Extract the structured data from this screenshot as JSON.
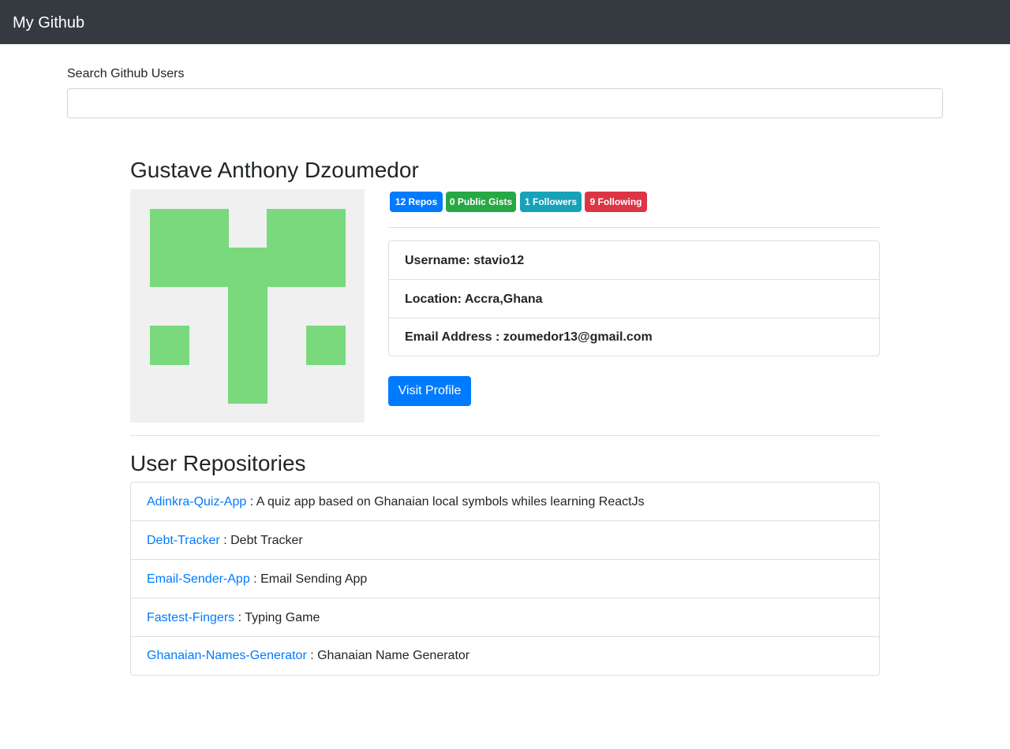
{
  "navbar": {
    "brand": "My Github"
  },
  "search": {
    "label": "Search Github Users",
    "value": "",
    "placeholder": ""
  },
  "user": {
    "name": "Gustave Anthony Dzoumedor",
    "avatar_color": "#79d97c",
    "badges": {
      "repos": "12 Repos",
      "gists": "0 Public Gists",
      "followers": "1 Followers",
      "following": "9 Following"
    },
    "info": {
      "username": "Username: stavio12",
      "location": "Location: Accra,Ghana",
      "email": "Email Address : zoumedor13@gmail.com"
    },
    "visit_button": "Visit Profile"
  },
  "repositories": {
    "title": "User Repositories",
    "separator": " : ",
    "items": [
      {
        "name": "Adinkra-Quiz-App",
        "description": "A quiz app based on Ghanaian local symbols whiles learning ReactJs"
      },
      {
        "name": "Debt-Tracker",
        "description": "Debt Tracker"
      },
      {
        "name": "Email-Sender-App",
        "description": "Email Sending App"
      },
      {
        "name": "Fastest-Fingers",
        "description": "Typing Game"
      },
      {
        "name": "Ghanaian-Names-Generator",
        "description": "Ghanaian Name Generator"
      }
    ]
  },
  "colors": {
    "navbar_bg": "#343a40",
    "primary": "#007bff",
    "success": "#28a745",
    "info": "#17a2b8",
    "danger": "#dc3545"
  }
}
